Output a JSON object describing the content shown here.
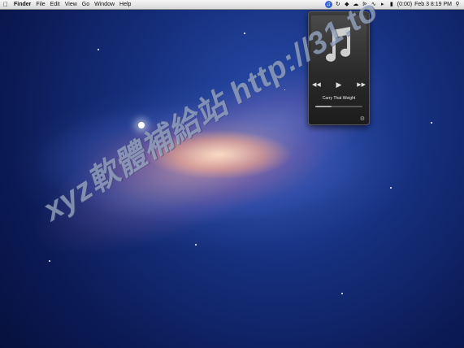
{
  "menubar": {
    "apple_icon": "apple-icon",
    "app_name": "Finder",
    "menus": [
      "File",
      "Edit",
      "View",
      "Go",
      "Window",
      "Help"
    ],
    "battery": "(0:00)",
    "clock": "Feb 3  8:19 PM"
  },
  "mini_player": {
    "track_title": "Carry That Weight",
    "progress": 0.35,
    "rewind_icon": "rewind-icon",
    "play_icon": "play-icon",
    "forward_icon": "fast-forward-icon"
  },
  "watermark": {
    "text": "xyz軟體補給站 http://31.to"
  },
  "colors": {
    "space": "#0b1a55",
    "accent": "#3a63d8"
  }
}
